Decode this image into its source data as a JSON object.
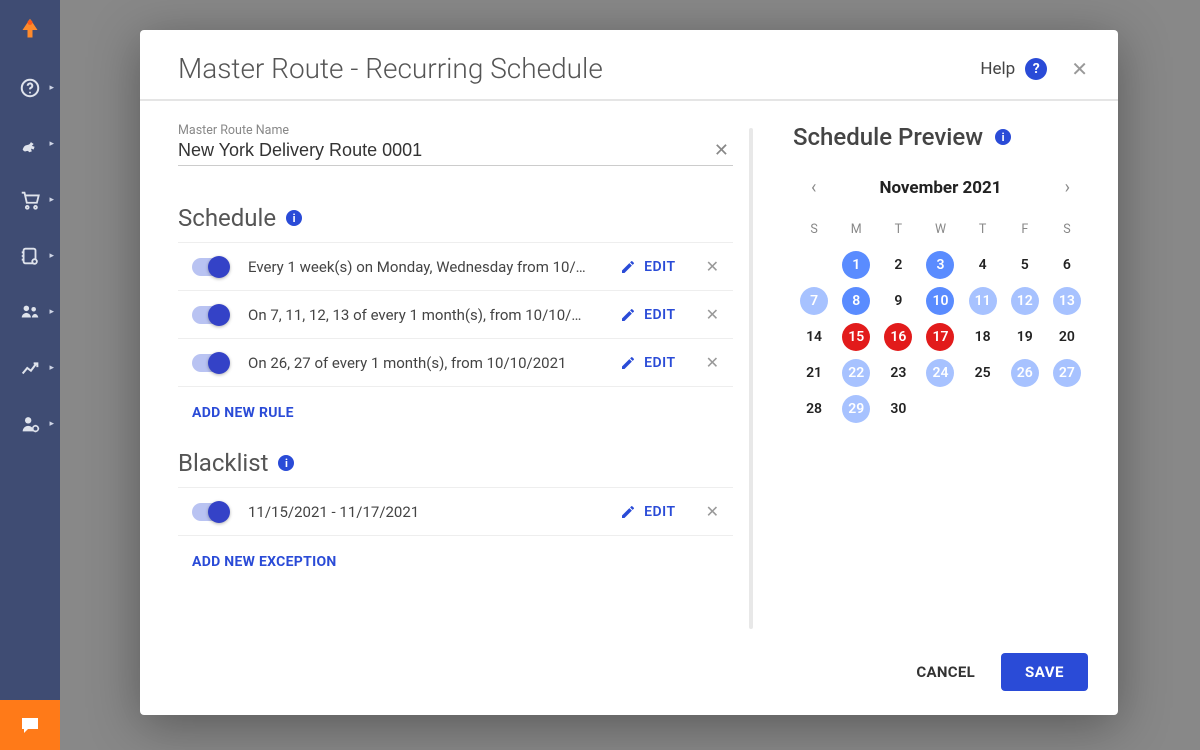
{
  "modal": {
    "title": "Master Route - Recurring Schedule",
    "help_label": "Help",
    "name_field_label": "Master Route Name",
    "name_value": "New York Delivery Route 0001",
    "sections": {
      "schedule": {
        "title": "Schedule",
        "rules": [
          "Every 1 week(s) on Monday, Wednesday from 10/…",
          "On 7, 11, 12, 13 of every 1 month(s), from 10/10/…",
          "On 26, 27 of every 1 month(s), from 10/10/2021"
        ],
        "add_label": "ADD NEW RULE"
      },
      "blacklist": {
        "title": "Blacklist",
        "rules": [
          "11/15/2021 - 11/17/2021"
        ],
        "add_label": "ADD NEW EXCEPTION"
      }
    },
    "edit_label": "EDIT",
    "preview_title": "Schedule Preview",
    "calendar": {
      "month": "November 2021",
      "dow": [
        "S",
        "M",
        "T",
        "W",
        "T",
        "F",
        "S"
      ],
      "days": [
        {
          "n": "",
          "s": ""
        },
        {
          "n": "1",
          "s": "blue-solid"
        },
        {
          "n": "2",
          "s": "plain"
        },
        {
          "n": "3",
          "s": "blue-solid"
        },
        {
          "n": "4",
          "s": "plain"
        },
        {
          "n": "5",
          "s": "plain"
        },
        {
          "n": "6",
          "s": "plain"
        },
        {
          "n": "7",
          "s": "blue-light"
        },
        {
          "n": "8",
          "s": "blue-solid"
        },
        {
          "n": "9",
          "s": "plain"
        },
        {
          "n": "10",
          "s": "blue-solid"
        },
        {
          "n": "11",
          "s": "blue-light"
        },
        {
          "n": "12",
          "s": "blue-light"
        },
        {
          "n": "13",
          "s": "blue-light"
        },
        {
          "n": "14",
          "s": "plain"
        },
        {
          "n": "15",
          "s": "red"
        },
        {
          "n": "16",
          "s": "red"
        },
        {
          "n": "17",
          "s": "red"
        },
        {
          "n": "18",
          "s": "plain"
        },
        {
          "n": "19",
          "s": "plain"
        },
        {
          "n": "20",
          "s": "plain"
        },
        {
          "n": "21",
          "s": "plain"
        },
        {
          "n": "22",
          "s": "blue-light"
        },
        {
          "n": "23",
          "s": "plain"
        },
        {
          "n": "24",
          "s": "blue-light"
        },
        {
          "n": "25",
          "s": "plain"
        },
        {
          "n": "26",
          "s": "blue-light"
        },
        {
          "n": "27",
          "s": "blue-light"
        },
        {
          "n": "28",
          "s": "plain"
        },
        {
          "n": "29",
          "s": "blue-light"
        },
        {
          "n": "30",
          "s": "plain"
        },
        {
          "n": "",
          "s": ""
        },
        {
          "n": "",
          "s": ""
        },
        {
          "n": "",
          "s": ""
        },
        {
          "n": "",
          "s": ""
        }
      ]
    },
    "footer": {
      "cancel": "CANCEL",
      "save": "SAVE"
    }
  },
  "sidebar_icons": [
    "logo",
    "help",
    "route",
    "cart",
    "book",
    "users",
    "chart",
    "user-gear"
  ]
}
